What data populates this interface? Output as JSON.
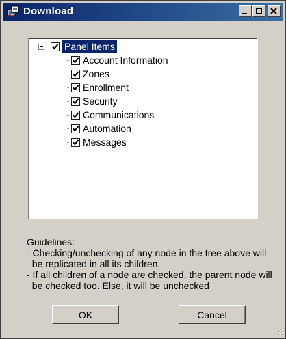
{
  "window": {
    "title": "Download"
  },
  "tree": {
    "root": {
      "label": "Panel Items",
      "checked": true,
      "expanded": true
    },
    "children": [
      {
        "label": "Account Information",
        "checked": true
      },
      {
        "label": "Zones",
        "checked": true
      },
      {
        "label": "Enrollment",
        "checked": true
      },
      {
        "label": "Security",
        "checked": true
      },
      {
        "label": "Communications",
        "checked": true
      },
      {
        "label": "Automation",
        "checked": true
      },
      {
        "label": "Messages",
        "checked": true
      }
    ]
  },
  "guidelines": {
    "heading": "Guidelines:",
    "lines": [
      "- Checking/unchecking of any node in the tree above will",
      "  be replicated in all its children.",
      "- If all children of a node are checked, the parent node will",
      "  be checked too. Else, it will be unchecked"
    ]
  },
  "buttons": {
    "ok": "OK",
    "cancel": "Cancel"
  },
  "colors": {
    "titlebar_start": "#0a246a",
    "titlebar_end": "#3a6ea5",
    "selection": "#0a246a",
    "face": "#d4d0c8"
  },
  "icons": [
    "download-window-icon",
    "minimize-icon",
    "maximize-icon",
    "close-icon",
    "collapse-icon",
    "checkmark-icon",
    "resize-grip-icon"
  ]
}
